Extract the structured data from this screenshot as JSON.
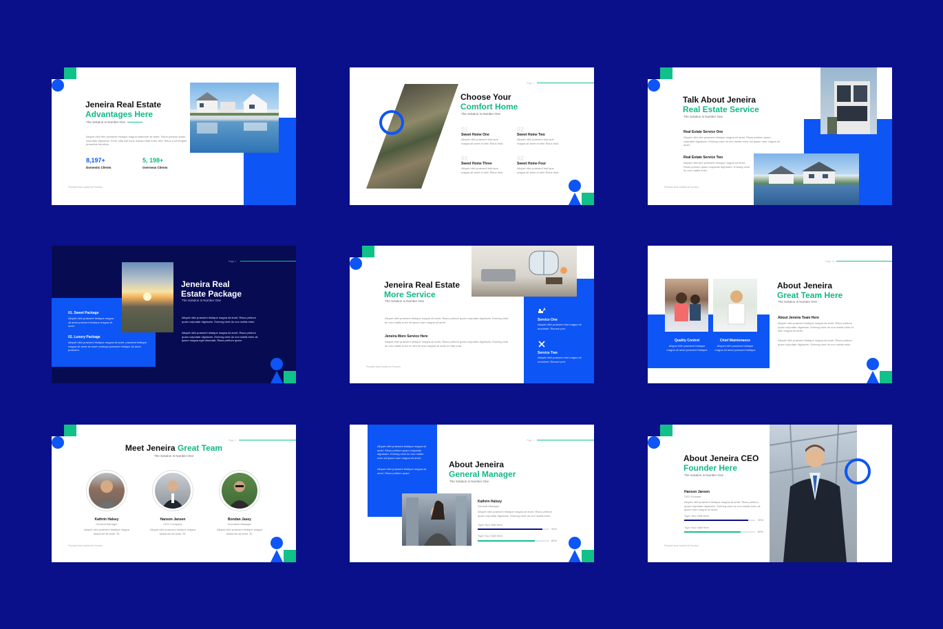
{
  "colors": {
    "background": "#0a0f8a",
    "accent_blue": "#0d55f5",
    "accent_green": "#12c08a",
    "dark_slide": "#070c52"
  },
  "slide1": {
    "title_line1": "Jeneira Real Estate",
    "title_line2": "Advantages Here",
    "subtitle": "The Solution Is Number One",
    "body": "Aliquet nibh titre praesent tristique magna sitamrnet sit amet. Risus pretium quam vulputate dignissim. Enim ultia nisl nunc massa vitae tortor amt. Risus a sit fringilla phasellus faucibus.",
    "stat1_value": "8,197+",
    "stat1_label": "Domestic Clients",
    "stat2_value": "5, 198+",
    "stat2_label": "Overseas Clients",
    "footer": "Pondant tean barked al Fonsbor"
  },
  "slide2": {
    "title_line1": "Choose Your",
    "title_line2": "Comfort Home",
    "subtitle": "The Solution Is Number One",
    "page": "Page 1",
    "items": [
      {
        "num": "01",
        "title": "Sweet Home One",
        "body": "Aliquet nibh praesent trsit ique magna sit amet et nibh Risus trisit."
      },
      {
        "num": "02",
        "title": "Sweet Home Two",
        "body": "Aliquet nibh praesent trsit ique magna sit amet et nibh Risus trisit."
      },
      {
        "num": "01",
        "title": "Sweet Home Three",
        "body": "Aliquet nibh praesent trsit ique magna sit amet et nibh Risus trisit."
      },
      {
        "num": "02",
        "title": "Sweet Home Four",
        "body": "Aliquet nibh praesent trsit ique magna sit amet et nibh Risus trisit."
      }
    ]
  },
  "slide3": {
    "title_line1": "Talk About Jeneira",
    "title_line2": "Real Estate Service",
    "subtitle": "The Solution Is Number One",
    "item1_title": "Real Estate Service One",
    "item1_body": "Aliquet nibh tete praesent tristique magna sit amet. Risus pretium quam vulputate dignissim. Enimeg cinet du non mattis enim oid ipsum nam magna sit amet.",
    "item2_title": "Real Estate Service Two",
    "item2_body": "Aliquet nibh tete praesent tristique magna sit amet. Risus pretium quam vulputate dignissim. Enimeg cinet du non mattis enim.",
    "footer": "Pondant tean barked al Fonsbor"
  },
  "slide4": {
    "title_line1": "Jeneira Real",
    "title_line2": "Estate Package",
    "subtitle": "The Solution Is Number One",
    "page": "Page 1",
    "pkg1_title": "01. Sweet Package",
    "pkg1_body": "Aliquet nibh praesent tristique magna sit amet praesent tristique magna sit amet.",
    "pkg2_title": "02. Luxury Package",
    "pkg2_body": "Aliquet nibh praesent tristique magna sit amet. praesent tristique magna sit amet sit amet conbsqd praesent tristique sit amet. praesent.",
    "body1": "Aliquet nibh praesent tristique magna sit amet. Risus pretium quam vulputate dignissim. Enimeg cinet du non mattis enim.",
    "body2": "Aliquet nibh praesent tristique magna sit amet. Risus pretium quam vulputate dignissim. Enimeg cinet du non mattis enim sit ipsum magna eget ditacdad. Risus pretium quam."
  },
  "slide5": {
    "title_line1": "Jeneira Real Estate",
    "title_line2": "More Service",
    "subtitle": "The Solution Is Number One",
    "body1": "Aliquet nibh praesent tristique magna sit amet. Risus pretium quam vulputate dignissim. Enimeg cinet du non mattis enim sit ipsum nam magna sit amet.",
    "item_title": "Jeneira More Service Here",
    "item_body": "Aliquet nibh praesent tristique magna sit amet. Risus pretium quam vulputate dignissim. Enimeg cinet du non mattis enim et nibh tie ipsa magna sit amet et nibh prae.",
    "service1_title": "Service One",
    "service1_body": "Aliquet nibh praesent trist magna sit amdolset. Risusre pret.",
    "service2_title": "Service Two",
    "service2_body": "Aliquet nibh praesent trist magna sit amdolset. Risusre pret.",
    "footer": "Pondant tean barked al Fonsbor",
    "icon1": "excavator-icon",
    "icon2": "tools-icon"
  },
  "slide6": {
    "title_line1": "About Jeneira",
    "title_line2": "Great Team Here",
    "subtitle": "The Solution Is Number One",
    "page": "Page 14",
    "card1_title": "Quality Control",
    "card1_body": "Aliquet nibh praesent tristique magna sit amet praesent tristique",
    "card2_title": "Chief Maintenance",
    "card2_body": "Aliquet nibh praesent tristique magna sit amet praesent tristique",
    "item_title": "About Jeneira Team Here",
    "body1": "Aliquet nibh praesent tristique magna sit amet. Risus pretium quam vulputate dignissim. Enimeg cinet du non mattis enim et nibh magna sit amet.",
    "body2": "Aliquet nibh praesent tristique magna sit amet. Risus pretium quam vulputate dignissim. Enimeg cinet du non mattis enim."
  },
  "slide7": {
    "title_black": "Meet Jeneira",
    "title_green": "Great Team",
    "subtitle": "The Solution Is Number One",
    "page": "Page 1",
    "members": [
      {
        "name": "Kathrin Halsey",
        "role": "General Manager",
        "body": "Aliquet nibh praesent tristique magna sitamrnet sit amet. Ri."
      },
      {
        "name": "Hanson Jansen",
        "role": "CEO Company",
        "body": "Aliquet nibh praesent tristique magna sitamrnet sit amet. Ri."
      },
      {
        "name": "Bondan Jasey",
        "role": "Executive Manager",
        "body": "Aliquet nibh praesent tristique magna sitamrnet sit amet. Ri."
      }
    ],
    "footer": "Pondant tean barked al Fonsbor"
  },
  "slide8": {
    "title_line1": "About Jeneira",
    "title_line2": "General Manager",
    "subtitle": "The Solution Is Number One",
    "page": "Page 1",
    "body1": "Aliquet nibh praesent tristique magna sit amet. Risus pretium quam vulputate dignissim. Enimeg cinet du non mattis enim sit ipsum nam magna sit amet.",
    "body2": "Aliquet nibh praesent tristique magna sit amet. Risus pretium quam",
    "name": "Kathrin Halsey",
    "role": "General Manager",
    "body3": "Aliquet nibh praesent tristique magna sit amet. Risus pretium quam vulputate dignissim. Enimeg cinet du non mattis enim.",
    "skill1_label": "Type Your Skill Here",
    "skill1_value": 0.9,
    "skill1_text": "90%",
    "skill2_label": "Type Your Skill Here",
    "skill2_value": 0.8,
    "skill2_text": "80%"
  },
  "slide9": {
    "title_line1": "About Jeneira CEO",
    "title_line2": "Founder Here",
    "subtitle": "The Solution Is Number One",
    "name": "Hanson Jansen",
    "role": "CEO Founder",
    "body": "Aliquet nibh praesent tristique magna sit amet. Risus pretium quam vulputate dignissim. Enimeg cinet du non mattis enim sit ipsum nam magna sit amet.",
    "skill1_label": "Type Your Skill Here",
    "skill1_value": 0.9,
    "skill1_text": "90%",
    "skill2_label": "Type Your Skill Here",
    "skill2_value": 0.8,
    "skill2_text": "80%",
    "footer": "Pondant tean barked al Fonsbor"
  }
}
